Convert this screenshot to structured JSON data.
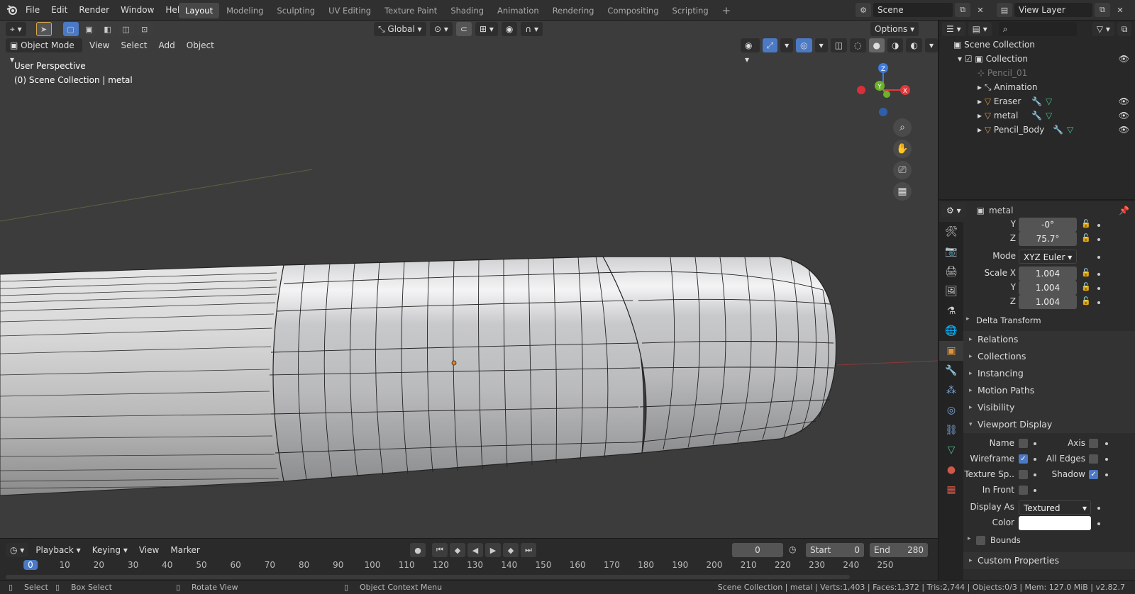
{
  "topbar": {
    "menus": [
      "File",
      "Edit",
      "Render",
      "Window",
      "Help"
    ],
    "workspaces": [
      "Layout",
      "Modeling",
      "Sculpting",
      "UV Editing",
      "Texture Paint",
      "Shading",
      "Animation",
      "Rendering",
      "Compositing",
      "Scripting"
    ],
    "active_workspace": "Layout",
    "add_tab_label": "+",
    "scene": "Scene",
    "view_layer": "View Layer"
  },
  "viewport": {
    "mode": "Object Mode",
    "menus": [
      "View",
      "Select",
      "Add",
      "Object"
    ],
    "transform_orientation": "Global",
    "options_label": "Options",
    "overlay_title": "User Perspective",
    "overlay_subtitle": "(0) Scene Collection | metal",
    "gizmo": {
      "x": "X",
      "y": "Y",
      "z": "Z"
    }
  },
  "outliner": {
    "search_placeholder": "",
    "root": "Scene Collection",
    "collection": "Collection",
    "items": [
      {
        "name": "Pencil_01",
        "dim": true
      },
      {
        "name": "Animation",
        "dim": false
      },
      {
        "name": "Eraser",
        "dim": false
      },
      {
        "name": "metal",
        "dim": false
      },
      {
        "name": "Pencil_Body",
        "dim": false
      }
    ]
  },
  "properties": {
    "object_name": "metal",
    "rotation": {
      "y_label": "Y",
      "y": "-0°",
      "z_label": "Z",
      "z": "75.7°"
    },
    "mode_label": "Mode",
    "mode": "XYZ Euler",
    "scale": {
      "x_label": "Scale X",
      "x": "1.004",
      "y_label": "Y",
      "y": "1.004",
      "z_label": "Z",
      "z": "1.004"
    },
    "panels": [
      "Delta Transform",
      "Relations",
      "Collections",
      "Instancing",
      "Motion Paths",
      "Visibility",
      "Viewport Display"
    ],
    "viewport_display": {
      "name_label": "Name",
      "name": false,
      "axis_label": "Axis",
      "axis": false,
      "wireframe_label": "Wireframe",
      "wireframe": true,
      "all_edges_label": "All Edges",
      "all_edges": false,
      "texture_space_label": "Texture Sp..",
      "texture_space": false,
      "shadow_label": "Shadow",
      "shadow": true,
      "in_front_label": "In Front",
      "in_front": false,
      "display_as_label": "Display As",
      "display_as": "Textured",
      "color_label": "Color",
      "color": "#ffffff",
      "bounds_label": "Bounds"
    },
    "custom_properties": "Custom Properties"
  },
  "timeline": {
    "menus": [
      "Playback",
      "Keying",
      "View",
      "Marker"
    ],
    "current_frame": "0",
    "start_label": "Start",
    "start": "0",
    "end_label": "End",
    "end": "280",
    "ruler": [
      "0",
      "10",
      "20",
      "30",
      "40",
      "50",
      "60",
      "70",
      "80",
      "90",
      "100",
      "110",
      "120",
      "130",
      "140",
      "150",
      "160",
      "170",
      "180",
      "190",
      "200",
      "210",
      "220",
      "230",
      "240",
      "250"
    ]
  },
  "statusbar": {
    "hints": [
      "Select",
      "Box Select",
      "Rotate View",
      "Object Context Menu"
    ],
    "stats": "Scene Collection | metal | Verts:1,403 | Faces:1,372 | Tris:2,744 | Objects:0/3 | Mem: 127.0 MiB | v2.82.7"
  },
  "colors": {
    "accent": "#4b79c4",
    "active_frame": "#4b79c4",
    "x_axis": "#e0393d",
    "y_axis": "#6cb12a",
    "z_axis": "#3d7be0"
  }
}
